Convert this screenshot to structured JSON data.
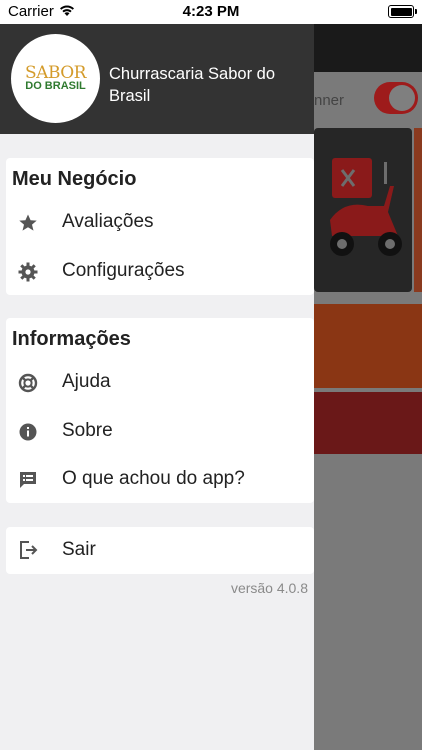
{
  "status_bar": {
    "carrier": "Carrier",
    "time": "4:23 PM"
  },
  "drawer": {
    "business_name": "Churrascaria Sabor do Brasil",
    "logo": {
      "line1": "SABOR",
      "line2": "DO BRASIL"
    },
    "sections": [
      {
        "title": "Meu Negócio",
        "items": [
          {
            "label": "Avaliações",
            "icon": "star-icon"
          },
          {
            "label": "Configurações",
            "icon": "gear-icon"
          }
        ]
      },
      {
        "title": "Informações",
        "items": [
          {
            "label": "Ajuda",
            "icon": "lifebuoy-icon"
          },
          {
            "label": "Sobre",
            "icon": "info-icon"
          },
          {
            "label": "O que achou do app?",
            "icon": "feedback-icon"
          }
        ]
      }
    ],
    "logout": {
      "label": "Sair",
      "icon": "logout-icon"
    },
    "version": "versão 4.0.8"
  },
  "background_app": {
    "label_fragment": "nner"
  },
  "colors": {
    "header_bg": "#333333",
    "drawer_bg": "#f0f0f2",
    "icon": "#555555"
  }
}
